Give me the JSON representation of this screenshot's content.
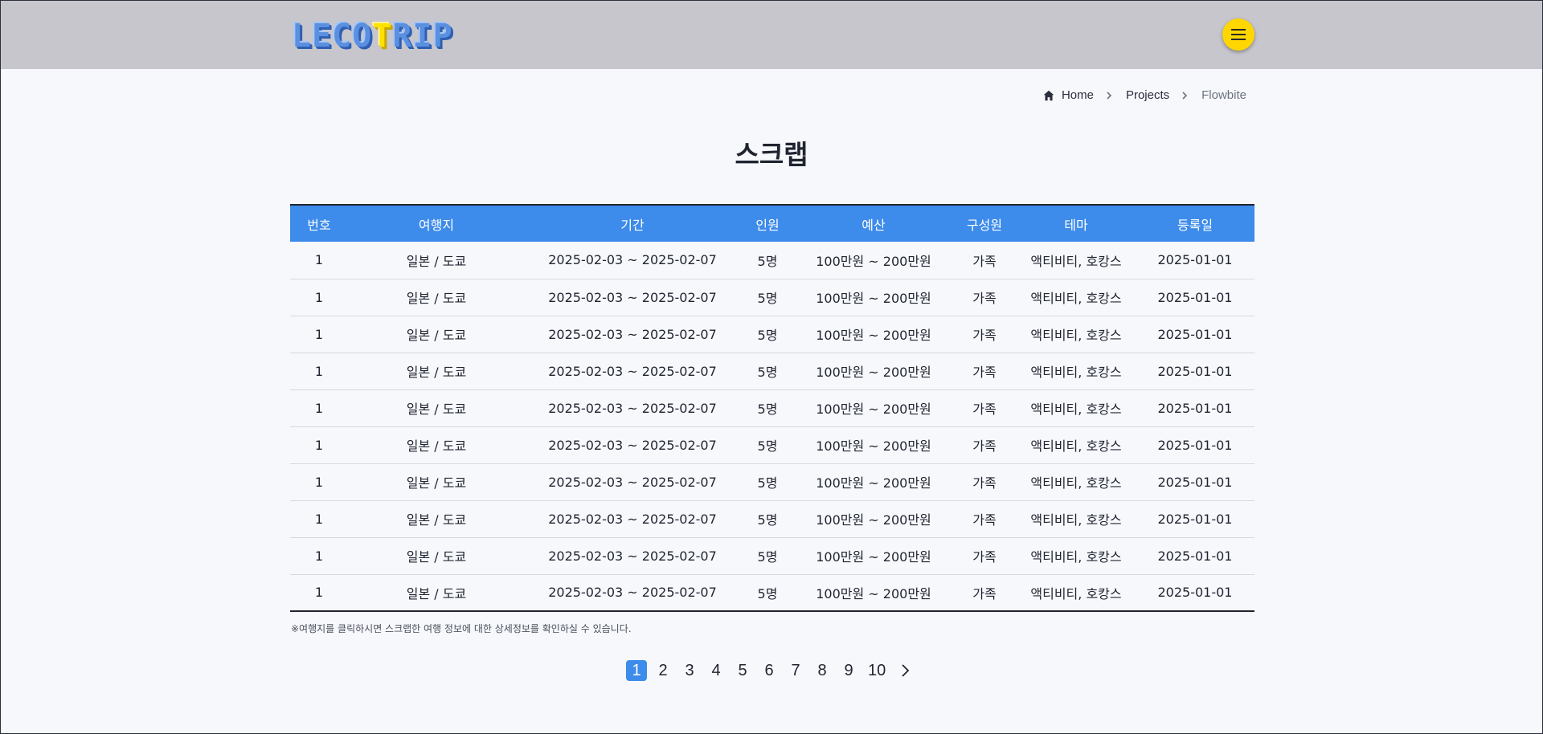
{
  "header": {
    "logo_text": "LECOTRIP",
    "logo_parts": [
      "LECO",
      "T",
      "RIP"
    ],
    "menu_icon": "hamburger-icon",
    "accent": "#ffd600"
  },
  "breadcrumb": {
    "items": [
      "Home",
      "Projects",
      "Flowbite"
    ],
    "home_icon": "home-icon",
    "separator_icon": "chevron-right-icon"
  },
  "page": {
    "title": "스크랩"
  },
  "table": {
    "header_color": "#3d8bea",
    "columns": [
      "번호",
      "여행지",
      "기간",
      "인원",
      "예산",
      "구성원",
      "테마",
      "등록일"
    ],
    "rows": [
      [
        "1",
        "일본 / 도쿄",
        "2025-02-03 ~ 2025-02-07",
        "5명",
        "100만원 ~ 200만원",
        "가족",
        "액티비티, 호캉스",
        "2025-01-01"
      ],
      [
        "1",
        "일본 / 도쿄",
        "2025-02-03 ~ 2025-02-07",
        "5명",
        "100만원 ~ 200만원",
        "가족",
        "액티비티, 호캉스",
        "2025-01-01"
      ],
      [
        "1",
        "일본 / 도쿄",
        "2025-02-03 ~ 2025-02-07",
        "5명",
        "100만원 ~ 200만원",
        "가족",
        "액티비티, 호캉스",
        "2025-01-01"
      ],
      [
        "1",
        "일본 / 도쿄",
        "2025-02-03 ~ 2025-02-07",
        "5명",
        "100만원 ~ 200만원",
        "가족",
        "액티비티, 호캉스",
        "2025-01-01"
      ],
      [
        "1",
        "일본 / 도쿄",
        "2025-02-03 ~ 2025-02-07",
        "5명",
        "100만원 ~ 200만원",
        "가족",
        "액티비티, 호캉스",
        "2025-01-01"
      ],
      [
        "1",
        "일본 / 도쿄",
        "2025-02-03 ~ 2025-02-07",
        "5명",
        "100만원 ~ 200만원",
        "가족",
        "액티비티, 호캉스",
        "2025-01-01"
      ],
      [
        "1",
        "일본 / 도쿄",
        "2025-02-03 ~ 2025-02-07",
        "5명",
        "100만원 ~ 200만원",
        "가족",
        "액티비티, 호캉스",
        "2025-01-01"
      ],
      [
        "1",
        "일본 / 도쿄",
        "2025-02-03 ~ 2025-02-07",
        "5명",
        "100만원 ~ 200만원",
        "가족",
        "액티비티, 호캉스",
        "2025-01-01"
      ],
      [
        "1",
        "일본 / 도쿄",
        "2025-02-03 ~ 2025-02-07",
        "5명",
        "100만원 ~ 200만원",
        "가족",
        "액티비티, 호캉스",
        "2025-01-01"
      ],
      [
        "1",
        "일본 / 도쿄",
        "2025-02-03 ~ 2025-02-07",
        "5명",
        "100만원 ~ 200만원",
        "가족",
        "액티비티, 호캉스",
        "2025-01-01"
      ]
    ]
  },
  "note": "※여행지를 클릭하시면 스크랩한 여행 정보에 대한 상세정보를 확인하실 수 있습니다.",
  "pagination": {
    "pages": [
      "1",
      "2",
      "3",
      "4",
      "5",
      "6",
      "7",
      "8",
      "9",
      "10"
    ],
    "current": "1",
    "next_icon": "chevron-right-icon"
  }
}
